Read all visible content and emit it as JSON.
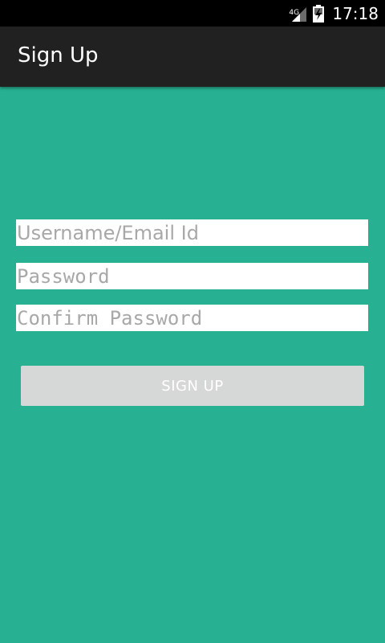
{
  "status_bar": {
    "network": "4G",
    "time": "17:18",
    "icons": [
      "signal-icon",
      "battery-charging-icon"
    ]
  },
  "app_bar": {
    "title": "Sign Up"
  },
  "form": {
    "username": {
      "placeholder": "Username/Email Id",
      "value": ""
    },
    "password": {
      "placeholder": "Password",
      "value": ""
    },
    "confirm_password": {
      "placeholder": "Confirm Password",
      "value": ""
    },
    "submit_label": "SIGN UP"
  },
  "colors": {
    "background": "#27b192",
    "app_bar": "#212121",
    "status_bar": "#000000",
    "button": "#d6d7d7",
    "placeholder": "#a8a8a8"
  }
}
